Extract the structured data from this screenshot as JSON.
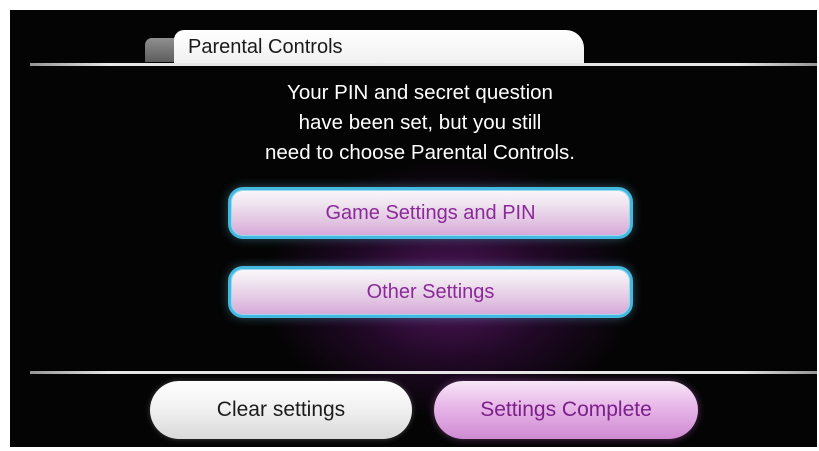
{
  "header": {
    "title": "Parental Controls"
  },
  "message": {
    "lines": [
      "Your PIN and secret question",
      "have been set, but you still",
      "need to choose Parental Controls."
    ]
  },
  "menu": {
    "game_settings_label": "Game Settings and PIN",
    "other_settings_label": "Other Settings"
  },
  "footer": {
    "clear_label": "Clear settings",
    "complete_label": "Settings Complete"
  },
  "colors": {
    "background": "#040404",
    "button_border": "#43b9df",
    "accent_text": "#8a2a98",
    "complete_button": "#e7b6e8"
  }
}
